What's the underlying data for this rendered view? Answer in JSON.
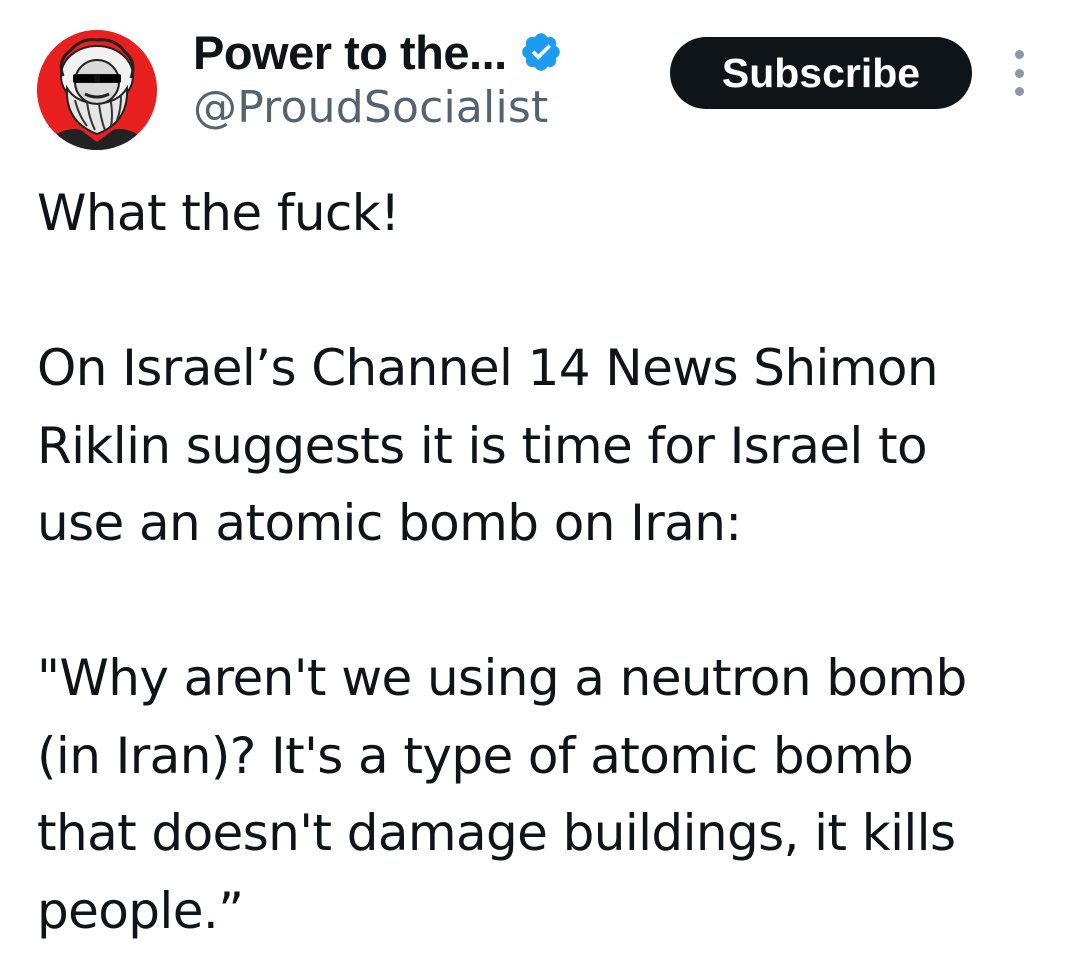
{
  "author": {
    "display_name": "Power to the...",
    "handle": "@ProudSocialist",
    "verified": true,
    "avatar_icon": "bearded-man-with-sunglasses-avatar",
    "avatar_bg": "#e8201f",
    "verified_color": "#1d9bf0"
  },
  "actions": {
    "subscribe_label": "Subscribe",
    "more_icon": "more-vertical-icon"
  },
  "tweet": {
    "paragraphs": [
      "What the fuck!",
      "On Israel’s Channel 14 News Shimon\nRiklin suggests it is time for Israel to\nuse an atomic bomb on Iran:",
      "\"Why aren't we using a neutron bomb\n(in Iran)?  It's a type of atomic bomb\nthat doesn't damage buildings, it kills\npeople.”"
    ]
  }
}
